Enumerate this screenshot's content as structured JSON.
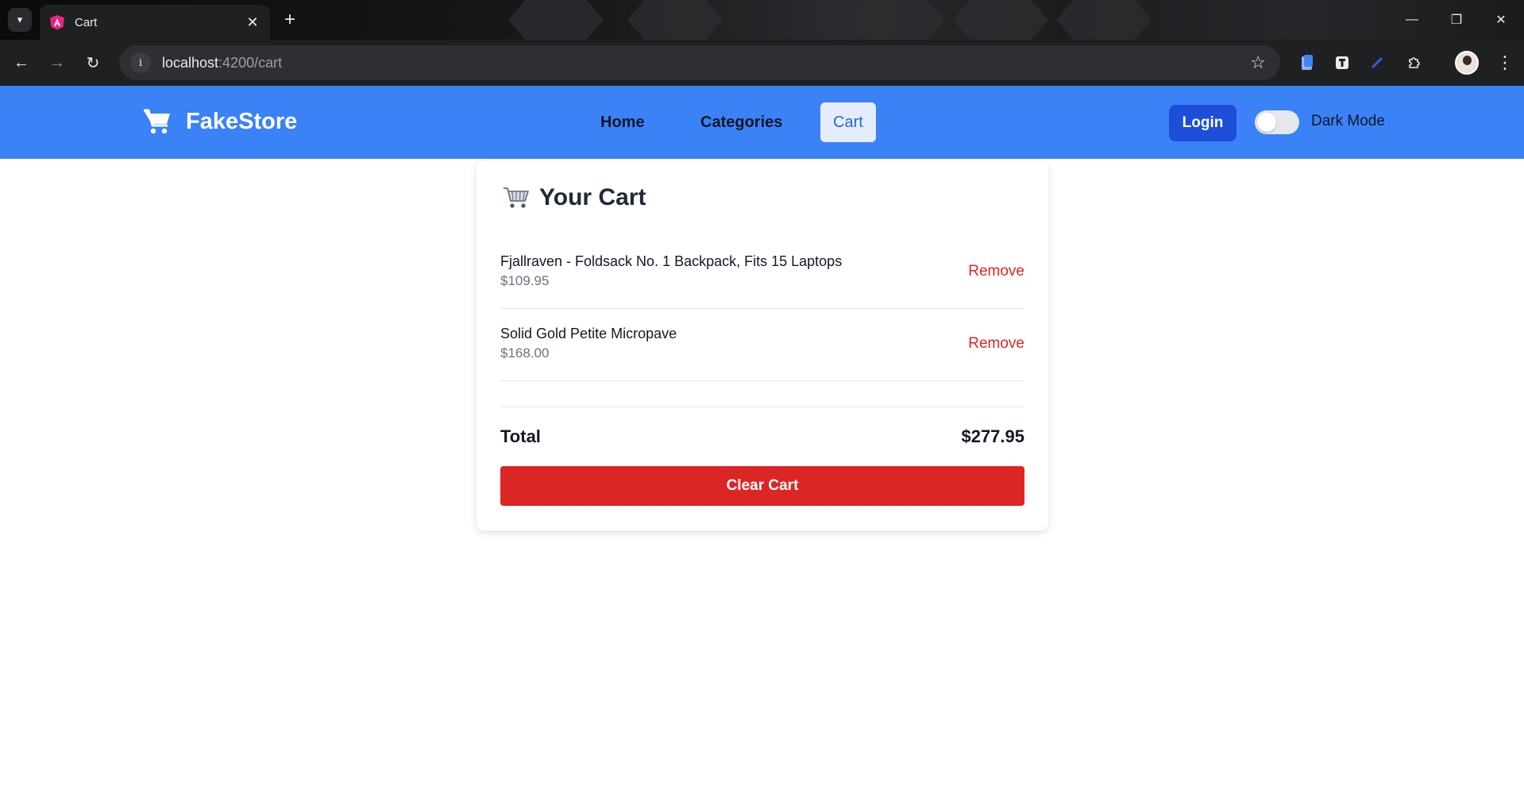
{
  "browser": {
    "tab_title": "Cart",
    "url_host": "localhost",
    "url_path": ":4200/cart",
    "icons": {
      "tab_list": "chevron-down-icon",
      "favicon": "angular-icon",
      "tab_close": "close-icon",
      "new_tab": "plus-icon",
      "back": "arrow-left-icon",
      "forward": "arrow-right-icon",
      "reload": "reload-icon",
      "site_info": "info-icon",
      "bookmark": "star-icon",
      "extensions": "puzzle-icon",
      "menu": "more-vertical-icon"
    }
  },
  "app": {
    "brand": "FakeStore",
    "nav": {
      "home": "Home",
      "categories": "Categories",
      "cart": "Cart",
      "active": "Cart"
    },
    "login_label": "Login",
    "dark_mode_label": "Dark Mode",
    "dark_mode_on": false,
    "colors": {
      "nav_bg": "#3b82f6",
      "login_bg": "#1d4ed8",
      "danger": "#dc2626"
    }
  },
  "cart": {
    "title": "Your Cart",
    "items": [
      {
        "name": "Fjallraven - Foldsack No. 1 Backpack, Fits 15 Laptops",
        "price": "$109.95",
        "remove_label": "Remove"
      },
      {
        "name": "Solid Gold Petite Micropave",
        "price": "$168.00",
        "remove_label": "Remove"
      }
    ],
    "total_label": "Total",
    "total_value": "$277.95",
    "clear_label": "Clear Cart"
  }
}
